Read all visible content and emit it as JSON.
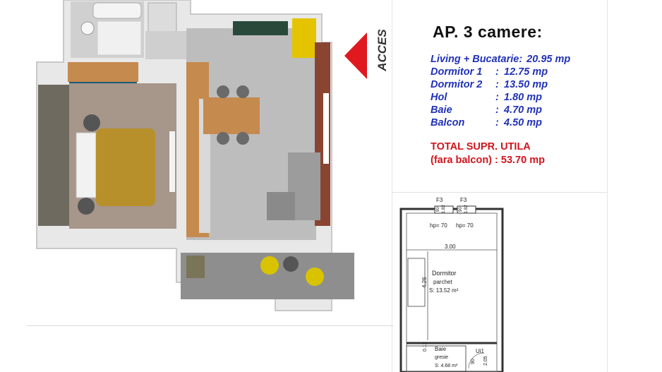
{
  "title": "AP. 3 camere:",
  "areas": [
    {
      "label": "Living + Bucatarie",
      "value": "20.95 mp"
    },
    {
      "label": "Dormitor 1",
      "value": "12.75 mp"
    },
    {
      "label": "Dormitor 2",
      "value": "13.50 mp"
    },
    {
      "label": "Hol",
      "value": "1.80 mp"
    },
    {
      "label": "Baie",
      "value": "4.70 mp"
    },
    {
      "label": "Balcon",
      "value": "4.50 mp"
    }
  ],
  "total_line1": "TOTAL SUPR. UTILA",
  "total_line2": "(fara balcon) : 53.70 mp",
  "access_label": "ACCES",
  "plan": {
    "window1": "F3",
    "window2": "F3",
    "dim_90a": "90",
    "dim_182a": "1.82",
    "dim_90b": "90",
    "dim_182b": "1.82",
    "hp1": "hp= 70",
    "hp2": "hp= 70",
    "width": "3.00",
    "height": "4.26",
    "room_name": "Dormitor",
    "room_floor": "parchet",
    "room_area": "S: 13.52 m²",
    "dim_012": "0.12",
    "bath_name": "Baie",
    "bath_floor": "gresie",
    "bath_area": "S: 4.68 m²",
    "door": "Ui1",
    "door_90": "90",
    "door_205": "2.05"
  },
  "colors": {
    "area_text": "#2031b8",
    "total_text": "#d2141c",
    "arrow": "#e0181f",
    "wall": "#e8e8e8",
    "floor_tile": "#bdbdbd",
    "parquet": "#a7968a",
    "bed": "#b8902b",
    "wood": "#c58a4e",
    "yellow": "#e4c400",
    "teal": "#1c5a78",
    "accent_wall": "#8a4432",
    "balcony_chair": "#d9c300"
  }
}
